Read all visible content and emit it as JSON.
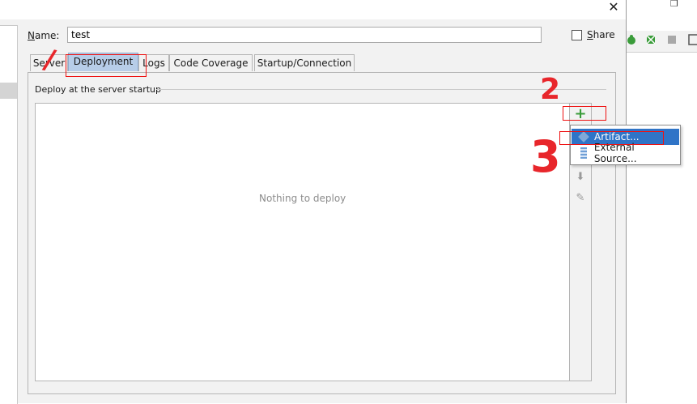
{
  "dialog": {
    "close_glyph": "✕",
    "name_label_first": "N",
    "name_label_rest": "ame:",
    "name_value": "test",
    "share_label_first": "S",
    "share_label_rest": "hare",
    "tabs": [
      "Server",
      "Deployment",
      "Logs",
      "Code Coverage",
      "Startup/Connection"
    ],
    "active_tab": "Deployment",
    "deploy_section_label": "Deploy at the server startup",
    "empty_list_text": "Nothing to deploy",
    "add_glyph": "+",
    "down_glyph": "⬇",
    "edit_glyph": "✎"
  },
  "popup_menu": {
    "items": [
      {
        "label": "Artifact...",
        "icon": "artifact-icon",
        "selected": true
      },
      {
        "label": "External Source...",
        "icon": "external-source-icon",
        "selected": false
      }
    ]
  },
  "annotations": {
    "step1": "/",
    "step2": "2",
    "step3": "3"
  },
  "colors": {
    "active_tab_bg": "#b7cde8",
    "selection_blue": "#2f74c7",
    "annotation_red": "#e8262b",
    "add_green": "#3a9c3a"
  },
  "background_window": {
    "maximize_glyph": "❐"
  }
}
